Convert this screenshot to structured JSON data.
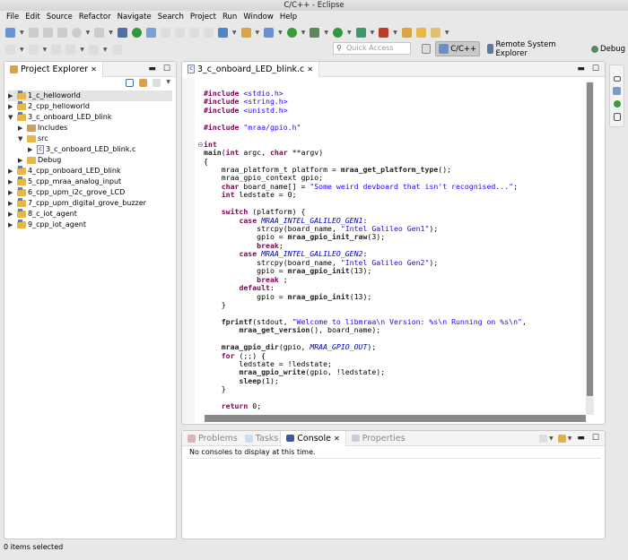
{
  "window": {
    "title": "C/C++ - Eclipse"
  },
  "menu": [
    "File",
    "Edit",
    "Source",
    "Refactor",
    "Navigate",
    "Search",
    "Project",
    "Run",
    "Window",
    "Help"
  ],
  "quick_access": {
    "placeholder": "Quick Access"
  },
  "perspectives": [
    {
      "label": "C/C++",
      "active": true
    },
    {
      "label": "Remote System Explorer",
      "active": false
    },
    {
      "label": "Debug",
      "active": false
    }
  ],
  "project_explorer": {
    "title": "Project Explorer",
    "items": [
      {
        "label": "1_c_helloworld",
        "level": 0,
        "expanded": false,
        "type": "project"
      },
      {
        "label": "2_cpp_helloworld",
        "level": 0,
        "expanded": false,
        "type": "project"
      },
      {
        "label": "3_c_onboard_LED_blink",
        "level": 0,
        "expanded": true,
        "type": "project"
      },
      {
        "label": "Includes",
        "level": 1,
        "expanded": false,
        "type": "includes"
      },
      {
        "label": "src",
        "level": 1,
        "expanded": true,
        "type": "folder"
      },
      {
        "label": "3_c_onboard_LED_blink.c",
        "level": 2,
        "expanded": false,
        "type": "cfile"
      },
      {
        "label": "Debug",
        "level": 1,
        "expanded": false,
        "type": "folder"
      },
      {
        "label": "4_cpp_onboard_LED_blink",
        "level": 0,
        "expanded": false,
        "type": "project"
      },
      {
        "label": "5_cpp_mraa_analog_input",
        "level": 0,
        "expanded": false,
        "type": "project"
      },
      {
        "label": "6_cpp_upm_i2c_grove_LCD",
        "level": 0,
        "expanded": false,
        "type": "project"
      },
      {
        "label": "7_cpp_upm_digital_grove_buzzer",
        "level": 0,
        "expanded": false,
        "type": "project"
      },
      {
        "label": "8_c_iot_agent",
        "level": 0,
        "expanded": false,
        "type": "project"
      },
      {
        "label": "9_cpp_iot_agent",
        "level": 0,
        "expanded": false,
        "type": "project"
      }
    ]
  },
  "editor": {
    "tab": "3_c_onboard_LED_blink.c",
    "lines": [
      [
        [
          "kw",
          "#include "
        ],
        [
          "hdr",
          "<stdio.h>"
        ]
      ],
      [
        [
          "kw",
          "#include "
        ],
        [
          "hdr",
          "<string.h>"
        ]
      ],
      [
        [
          "kw",
          "#include "
        ],
        [
          "hdr",
          "<unistd.h>"
        ]
      ],
      [],
      [
        [
          "kw",
          "#include "
        ],
        [
          "hdr",
          "\"mraa/gpio.h\""
        ]
      ],
      [],
      [
        [
          "kw",
          "int"
        ]
      ],
      [
        [
          "fn",
          "main"
        ],
        [
          "",
          "("
        ],
        [
          "kw",
          "int"
        ],
        [
          "",
          " argc, "
        ],
        [
          "kw",
          "char"
        ],
        [
          "",
          " **argv)"
        ]
      ],
      [
        [
          "",
          "{"
        ]
      ],
      [
        [
          "",
          "    mraa_platform_t platform = "
        ],
        [
          "fn",
          "mraa_get_platform_type"
        ],
        [
          "",
          "();"
        ]
      ],
      [
        [
          "",
          "    mraa_gpio_context gpio;"
        ]
      ],
      [
        [
          "",
          "    "
        ],
        [
          "kw",
          "char"
        ],
        [
          "",
          " board_name[] = "
        ],
        [
          "str",
          "\"Some weird devboard that isn't recognised...\""
        ],
        [
          "",
          ";"
        ]
      ],
      [
        [
          "",
          "    "
        ],
        [
          "kw",
          "int"
        ],
        [
          "",
          " ledstate = 0;"
        ]
      ],
      [],
      [
        [
          "",
          "    "
        ],
        [
          "kw",
          "switch"
        ],
        [
          "",
          " (platform) {"
        ]
      ],
      [
        [
          "",
          "        "
        ],
        [
          "kw",
          "case"
        ],
        [
          "",
          " "
        ],
        [
          "mac",
          "MRAA_INTEL_GALILEO_GEN1"
        ],
        [
          "",
          ":"
        ]
      ],
      [
        [
          "",
          "            strcpy(board_name, "
        ],
        [
          "str",
          "\"Intel Galileo Gen1\""
        ],
        [
          "",
          ");"
        ]
      ],
      [
        [
          "",
          "            gpio = "
        ],
        [
          "fn",
          "mraa_gpio_init_raw"
        ],
        [
          "",
          "(3);"
        ]
      ],
      [
        [
          "",
          "            "
        ],
        [
          "kw",
          "break"
        ],
        [
          "",
          ";"
        ]
      ],
      [
        [
          "",
          "        "
        ],
        [
          "kw",
          "case"
        ],
        [
          "",
          " "
        ],
        [
          "mac",
          "MRAA_INTEL_GALILEO_GEN2"
        ],
        [
          "",
          ":"
        ]
      ],
      [
        [
          "",
          "            strcpy(board_name, "
        ],
        [
          "str",
          "\"Intel Galileo Gen2\""
        ],
        [
          "",
          ");"
        ]
      ],
      [
        [
          "",
          "            gpio = "
        ],
        [
          "fn",
          "mraa_gpio_init"
        ],
        [
          "",
          "(13);"
        ]
      ],
      [
        [
          "",
          "            "
        ],
        [
          "kw",
          "break"
        ],
        [
          "",
          " ;"
        ]
      ],
      [
        [
          "",
          "        "
        ],
        [
          "kw",
          "default"
        ],
        [
          "",
          ":"
        ]
      ],
      [
        [
          "",
          "            gpio = "
        ],
        [
          "fn",
          "mraa_gpio_init"
        ],
        [
          "",
          "(13);"
        ]
      ],
      [
        [
          "",
          "    }"
        ]
      ],
      [],
      [
        [
          "",
          "    "
        ],
        [
          "fn",
          "fprintf"
        ],
        [
          "",
          "(stdout, "
        ],
        [
          "str",
          "\"Welcome to libmraa\\n Version: %s\\n Running on %s\\n\""
        ],
        [
          "",
          ","
        ]
      ],
      [
        [
          "",
          "        "
        ],
        [
          "fn",
          "mraa_get_version"
        ],
        [
          "",
          "(), board_name);"
        ]
      ],
      [],
      [
        [
          "",
          "    "
        ],
        [
          "fn",
          "mraa_gpio_dir"
        ],
        [
          "",
          "(gpio, "
        ],
        [
          "mac",
          "MRAA_GPIO_OUT"
        ],
        [
          "",
          ");"
        ]
      ],
      [
        [
          "",
          "    "
        ],
        [
          "kw",
          "for"
        ],
        [
          "",
          " (;;) {"
        ]
      ],
      [
        [
          "",
          "        ledstate = !ledstate;"
        ]
      ],
      [
        [
          "",
          "        "
        ],
        [
          "fn",
          "mraa_gpio_write"
        ],
        [
          "",
          "(gpio, !ledstate);"
        ]
      ],
      [
        [
          "",
          "        "
        ],
        [
          "fn",
          "sleep"
        ],
        [
          "",
          "(1);"
        ]
      ],
      [
        [
          "",
          "    }"
        ]
      ],
      [],
      [
        [
          "",
          "    "
        ],
        [
          "kw",
          "return"
        ],
        [
          "",
          " 0;"
        ]
      ]
    ]
  },
  "bottom_panel": {
    "tabs": [
      {
        "label": "Problems",
        "active": false
      },
      {
        "label": "Tasks",
        "active": false
      },
      {
        "label": "Console",
        "active": true
      },
      {
        "label": "Properties",
        "active": false
      }
    ],
    "message": "No consoles to display at this time."
  },
  "status_bar": {
    "text": "0 items selected"
  }
}
